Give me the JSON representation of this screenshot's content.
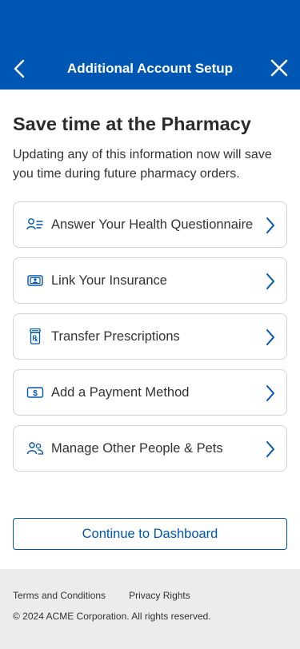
{
  "header": {
    "title": "Additional Account Setup",
    "back_icon": "chevron-left-icon",
    "close_icon": "close-icon",
    "background_color": "#0056b3"
  },
  "main": {
    "title": "Save time at the Pharmacy",
    "intro": "Updating any of this information now will save you time during future pharmacy orders.",
    "items": [
      {
        "label": "Answer Your Health Questionnaire",
        "icon": "questionnaire-icon"
      },
      {
        "label": "Link Your Insurance",
        "icon": "insurance-card-icon"
      },
      {
        "label": "Transfer Prescriptions",
        "icon": "prescription-bottle-icon"
      },
      {
        "label": "Add a Payment Method",
        "icon": "payment-icon"
      },
      {
        "label": "Manage Other People & Pets",
        "icon": "people-icon"
      }
    ],
    "chevron_icon": "chevron-right-icon",
    "accent_color": "#0056b3"
  },
  "continue_button": {
    "label": "Continue to Dashboard"
  },
  "footer": {
    "links": [
      "Terms and Conditions",
      "Privacy Rights"
    ],
    "copyright": "© 2024 ACME Corporation. All rights reserved."
  }
}
